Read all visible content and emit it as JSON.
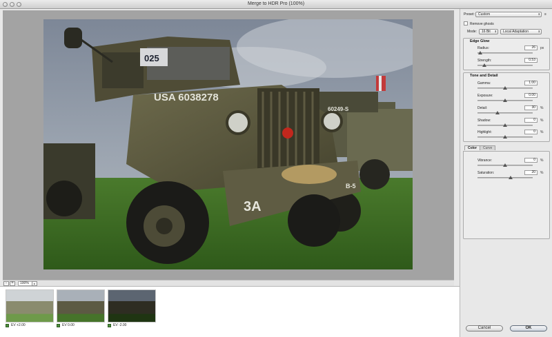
{
  "window": {
    "title": "Merge to HDR Pro (100%)"
  },
  "preview": {
    "zoom_value": "100%",
    "zoom_out_label": "-",
    "zoom_in_label": "+",
    "photo": {
      "door_number": "025",
      "hood_text": "USA 6038278",
      "bumper_text": "3A",
      "bumper_text_2": "B-5",
      "second_truck_text": "60249-S"
    }
  },
  "filmstrip": {
    "items": [
      {
        "label": "EV +2.00",
        "checked": true
      },
      {
        "label": "EV 0.00",
        "checked": true
      },
      {
        "label": "EV -2.00",
        "checked": true
      }
    ]
  },
  "panel": {
    "preset_label": "Preset:",
    "preset_value": "Custom",
    "preset_menu_glyph": "≡",
    "remove_ghosts_label": "Remove ghosts",
    "remove_ghosts_checked": false,
    "mode_label": "Mode:",
    "mode_bits": "16 Bit",
    "mode_method": "Local Adaptation",
    "edge_glow": {
      "title": "Edge Glow",
      "radius_label": "Radius:",
      "radius_value": "26",
      "radius_unit": "px",
      "radius_frac": 0.05,
      "strength_label": "Strength:",
      "strength_value": "0.53",
      "strength_frac": 0.12
    },
    "tone_detail": {
      "title": "Tone and Detail",
      "gamma_label": "Gamma:",
      "gamma_value": "1.00",
      "gamma_frac": 0.5,
      "exposure_label": "Exposure:",
      "exposure_value": "0.00",
      "exposure_frac": 0.5,
      "detail_label": "Detail:",
      "detail_value": "30",
      "detail_unit": "%",
      "detail_frac": 0.36,
      "shadow_label": "Shadow:",
      "shadow_value": "0",
      "shadow_unit": "%",
      "shadow_frac": 0.5,
      "highlight_label": "Highlight:",
      "highlight_value": "0",
      "highlight_unit": "%",
      "highlight_frac": 0.5
    },
    "tabs": {
      "color": "Color",
      "curve": "Curve"
    },
    "color": {
      "vibrance_label": "Vibrance:",
      "vibrance_value": "0",
      "vibrance_unit": "%",
      "vibrance_frac": 0.5,
      "saturation_label": "Saturation:",
      "saturation_value": "20",
      "saturation_unit": "%",
      "saturation_frac": 0.6
    },
    "cancel_label": "Cancel",
    "ok_label": "OK"
  }
}
